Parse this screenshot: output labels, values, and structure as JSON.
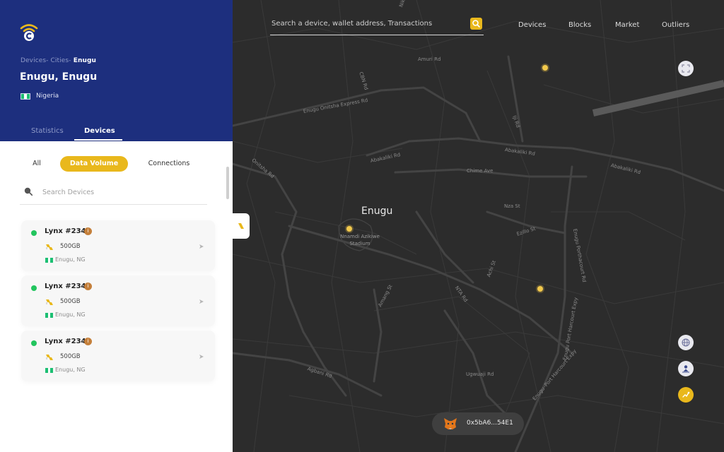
{
  "breadcrumb": {
    "devices": "Devices-",
    "cities": " Cities-",
    "current": " Enugu"
  },
  "location": {
    "title": "Enugu, Enugu",
    "country": "Nigeria"
  },
  "header_tabs": {
    "statistics": "Statistics",
    "devices": "Devices"
  },
  "filters": {
    "all": "All",
    "data_volume": "Data Volume",
    "connections": "Connections"
  },
  "device_search": {
    "placeholder": "Search Devices"
  },
  "devices": [
    {
      "name": "Lynx #234",
      "badge": "i",
      "volume": "500GB",
      "location": "Enugu, NG"
    },
    {
      "name": "Lynx #234",
      "badge": "i",
      "volume": "500GB",
      "location": "Enugu, NG"
    },
    {
      "name": "Lynx #234",
      "badge": "i",
      "volume": "500GB",
      "location": "Enugu, NG"
    }
  ],
  "top_search": {
    "placeholder": "Search a device, wallet address, Transactions"
  },
  "nav": {
    "devices": "Devices",
    "blocks": "Blocks",
    "market": "Market",
    "outliers": "Outliers"
  },
  "map": {
    "city": "Enugu",
    "poi": "Nnamdi Azikiwe Stadium",
    "roads": {
      "amuri": "Amuri Rd",
      "cbn": "CBN Rd",
      "onitsha_express": "Enugu Onitsha Express Rd",
      "iji": "Iji Rd",
      "onitsha": "Onitsha Rd",
      "abakaliki_1": "Abakaliki Rd",
      "abakaliki_2": "Abakaliki Rd",
      "abakaliki_3": "Abakaliki Rd",
      "chime": "Chime Ave",
      "nza": "Nza St",
      "ezillo": "Ezillo St",
      "ph_rd": "Enugu Porthacourt Rd",
      "achi": "Achi St",
      "nta": "NTA Rd",
      "amang": "Amang St",
      "ph_expy_1": "Enugu Port Harcourt Expy",
      "ph_expy_2": "Enugu–Port Harcourt Expy",
      "agbani": "Agbani Rd",
      "ugwuaji": "Ugwuaji Rd",
      "nike": "Nike"
    }
  },
  "wallet": {
    "address": "0x5bA6...54E1"
  },
  "colors": {
    "panel_header": "#1d2f7e",
    "accent": "#e9b81c",
    "online": "#22c55e",
    "map_bg": "#2c2c2c"
  }
}
